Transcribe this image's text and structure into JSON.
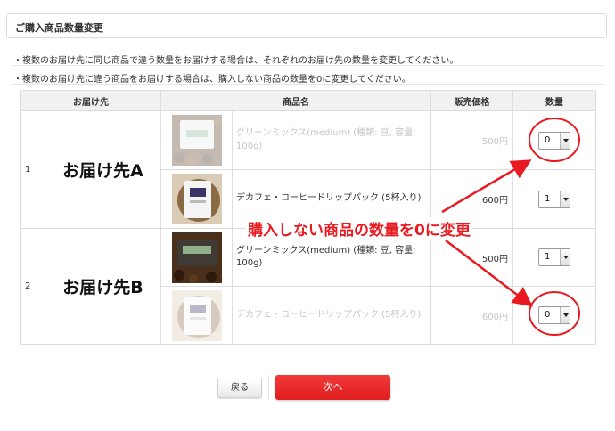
{
  "header": {
    "title": "ご購入商品数量変更"
  },
  "notes": [
    "・複数のお届け先に同じ商品で違う数量をお届けする場合は、それぞれのお届け先の数量を変更してください。",
    "・複数のお届け先に違う商品をお届けする場合は、購入しない商品の数量を0に変更してください。"
  ],
  "table": {
    "columns": [
      "お届け先",
      "商品名",
      "販売価格",
      "数量"
    ],
    "groups": [
      {
        "index": "1",
        "destination": "お届け先A",
        "items": [
          {
            "name": "グリーンミックス(medium) (種類: 豆, 容量: 100g)",
            "price": "500円",
            "qty": "0",
            "dimmed": true,
            "image": "green-mix-bag"
          },
          {
            "name": "デカフェ・コーヒードリップパック (5杯入り)",
            "price": "600円",
            "qty": "1",
            "dimmed": false,
            "image": "decaf-drip-pack"
          }
        ]
      },
      {
        "index": "2",
        "destination": "お届け先B",
        "items": [
          {
            "name": "グリーンミックス(medium) (種類: 豆, 容量: 100g)",
            "price": "500円",
            "qty": "1",
            "dimmed": false,
            "image": "green-mix-bag"
          },
          {
            "name": "デカフェ・コーヒードリップパック (5杯入り)",
            "price": "600円",
            "qty": "0",
            "dimmed": true,
            "image": "decaf-drip-pack"
          }
        ]
      }
    ]
  },
  "annotation": {
    "text": "購入しない商品の数量を0に変更",
    "color": "#e8191f"
  },
  "buttons": {
    "back": "戻る",
    "next": "次へ"
  },
  "colors": {
    "accent": "#e8191f",
    "next_button": "#e62626"
  }
}
